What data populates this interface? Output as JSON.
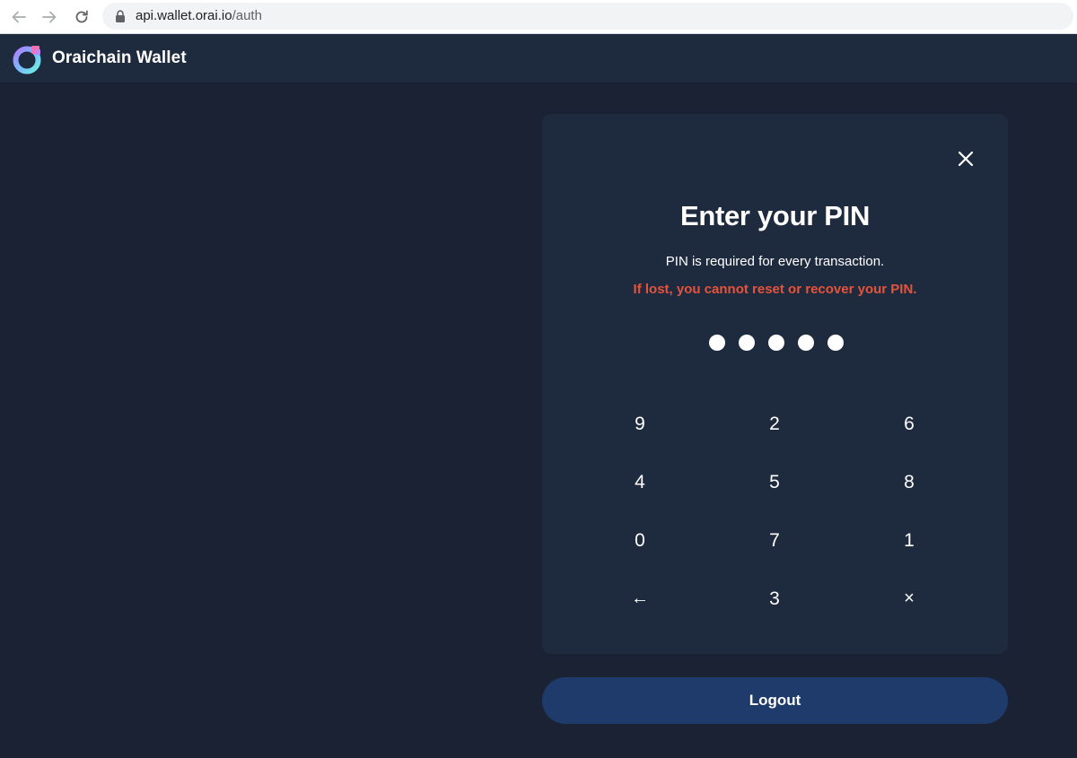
{
  "browser": {
    "url_host": "api.wallet.orai.io",
    "url_path": "/auth"
  },
  "header": {
    "title": "Oraichain Wallet",
    "logo_icon": "oraichain-logo-icon"
  },
  "pin_dialog": {
    "title": "Enter your PIN",
    "subtitle": "PIN is required for every transaction.",
    "warning": "If lost, you cannot reset or recover your PIN.",
    "warning_color": "#e5533d",
    "dots_count": 5,
    "close_icon": "close-icon",
    "keypad": {
      "rows": [
        [
          "9",
          "2",
          "6"
        ],
        [
          "4",
          "5",
          "8"
        ],
        [
          "0",
          "7",
          "1"
        ],
        [
          "←",
          "3",
          "×"
        ]
      ]
    }
  },
  "logout": {
    "label": "Logout",
    "color": "#1f3b6b"
  },
  "colors": {
    "background": "#1a2233",
    "panel": "#1e2b3e"
  }
}
